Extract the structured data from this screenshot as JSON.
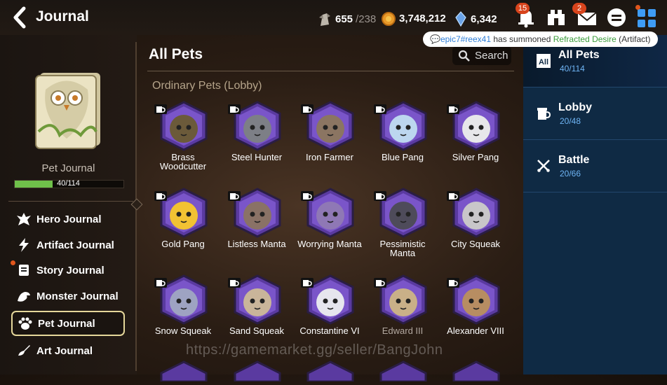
{
  "header": {
    "title": "Journal",
    "stamina": {
      "value": "655",
      "cap": "/238"
    },
    "gold": "3,748,212",
    "crystals": "6,342",
    "notifications_badge": "15",
    "mail_badge": "2"
  },
  "notice": {
    "user": "epic7#reex41",
    "middle": " has summoned ",
    "item": "Refracted Desire",
    "suffix": " (Artifact)"
  },
  "left": {
    "journal_label": "Pet Journal",
    "progress_text": "40/114",
    "progress_fraction": 0.35,
    "menu": [
      {
        "label": "Hero Journal",
        "icon": "hero-icon"
      },
      {
        "label": "Artifact Journal",
        "icon": "lightning-icon"
      },
      {
        "label": "Story Journal",
        "icon": "scroll-icon"
      },
      {
        "label": "Monster Journal",
        "icon": "dragon-icon"
      },
      {
        "label": "Pet Journal",
        "icon": "paw-icon"
      },
      {
        "label": "Art Journal",
        "icon": "brush-icon"
      }
    ]
  },
  "main": {
    "title": "All Pets",
    "search_label": "Search",
    "subheading": "Ordinary Pets (Lobby)",
    "pets": [
      {
        "name": "Brass\nWoodcutter",
        "color": "#6b5a3a",
        "dim": false
      },
      {
        "name": "Steel Hunter",
        "color": "#7d7f86",
        "dim": false
      },
      {
        "name": "Iron Farmer",
        "color": "#8b7562",
        "dim": false
      },
      {
        "name": "Blue Pang",
        "color": "#bcd6ef",
        "dim": false
      },
      {
        "name": "Silver Pang",
        "color": "#e7e7ea",
        "dim": false
      },
      {
        "name": "Gold Pang",
        "color": "#f2c233",
        "dim": false
      },
      {
        "name": "Listless Manta",
        "color": "#8a7266",
        "dim": false
      },
      {
        "name": "Worrying Manta",
        "color": "#8f78b5",
        "dim": false
      },
      {
        "name": "Pessimistic\nManta",
        "color": "#4e4b5a",
        "dim": false
      },
      {
        "name": "City Squeak",
        "color": "#c8c6c9",
        "dim": false
      },
      {
        "name": "Snow Squeak",
        "color": "#9ea3c2",
        "dim": false
      },
      {
        "name": "Sand Squeak",
        "color": "#c9b59a",
        "dim": false
      },
      {
        "name": "Constantine VI",
        "color": "#e6e6ee",
        "dim": false
      },
      {
        "name": "Edward III",
        "color": "#c9b088",
        "dim": true
      },
      {
        "name": "Alexander VIII",
        "color": "#b78d62",
        "dim": false
      }
    ]
  },
  "right": {
    "tabs": [
      {
        "name": "All Pets",
        "count": "40/114",
        "icon": "all-icon"
      },
      {
        "name": "Lobby",
        "count": "20/48",
        "icon": "mug-icon"
      },
      {
        "name": "Battle",
        "count": "20/66",
        "icon": "crossed-swords-icon"
      }
    ]
  },
  "watermark": "https://gamemarket.gg/seller/BangJohn"
}
